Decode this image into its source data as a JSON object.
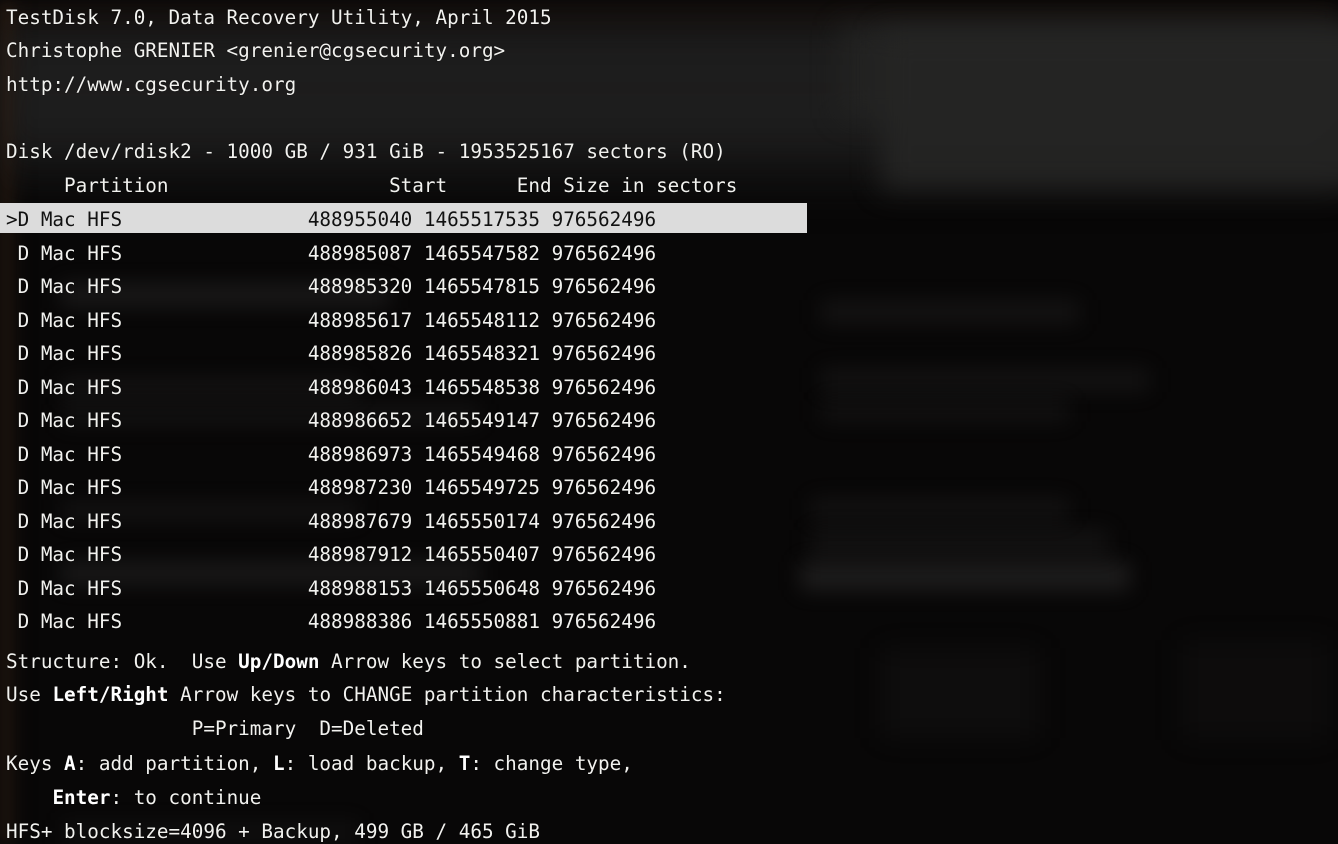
{
  "app": {
    "title_line": "TestDisk 7.0, Data Recovery Utility, April 2015",
    "author_line": "Christophe GRENIER <grenier@cgsecurity.org>",
    "website_line": "http://www.cgsecurity.org"
  },
  "disk": {
    "info_line": "Disk /dev/rdisk2 - 1000 GB / 931 GiB - 1953525167 sectors (RO)",
    "device": "/dev/rdisk2",
    "size_gb": "1000 GB",
    "size_gib": "931 GiB",
    "sectors": "1953525167",
    "mode": "RO"
  },
  "table": {
    "headers": {
      "partition": "Partition",
      "start": "Start",
      "end": "End",
      "size": "Size in sectors"
    },
    "selected_index": 0,
    "selection_marker": ">",
    "rows": [
      {
        "marker": ">",
        "flag": "D",
        "type": "Mac HFS",
        "start": "488955040",
        "end": "1465517535",
        "size": "976562496",
        "selected": true
      },
      {
        "marker": " ",
        "flag": "D",
        "type": "Mac HFS",
        "start": "488985087",
        "end": "1465547582",
        "size": "976562496",
        "selected": false
      },
      {
        "marker": " ",
        "flag": "D",
        "type": "Mac HFS",
        "start": "488985320",
        "end": "1465547815",
        "size": "976562496",
        "selected": false
      },
      {
        "marker": " ",
        "flag": "D",
        "type": "Mac HFS",
        "start": "488985617",
        "end": "1465548112",
        "size": "976562496",
        "selected": false
      },
      {
        "marker": " ",
        "flag": "D",
        "type": "Mac HFS",
        "start": "488985826",
        "end": "1465548321",
        "size": "976562496",
        "selected": false
      },
      {
        "marker": " ",
        "flag": "D",
        "type": "Mac HFS",
        "start": "488986043",
        "end": "1465548538",
        "size": "976562496",
        "selected": false
      },
      {
        "marker": " ",
        "flag": "D",
        "type": "Mac HFS",
        "start": "488986652",
        "end": "1465549147",
        "size": "976562496",
        "selected": false
      },
      {
        "marker": " ",
        "flag": "D",
        "type": "Mac HFS",
        "start": "488986973",
        "end": "1465549468",
        "size": "976562496",
        "selected": false
      },
      {
        "marker": " ",
        "flag": "D",
        "type": "Mac HFS",
        "start": "488987230",
        "end": "1465549725",
        "size": "976562496",
        "selected": false
      },
      {
        "marker": " ",
        "flag": "D",
        "type": "Mac HFS",
        "start": "488987679",
        "end": "1465550174",
        "size": "976562496",
        "selected": false
      },
      {
        "marker": " ",
        "flag": "D",
        "type": "Mac HFS",
        "start": "488987912",
        "end": "1465550407",
        "size": "976562496",
        "selected": false
      },
      {
        "marker": " ",
        "flag": "D",
        "type": "Mac HFS",
        "start": "488988153",
        "end": "1465550648",
        "size": "976562496",
        "selected": false
      },
      {
        "marker": " ",
        "flag": "D",
        "type": "Mac HFS",
        "start": "488988386",
        "end": "1465550881",
        "size": "976562496",
        "selected": false
      }
    ]
  },
  "status": {
    "structure_prefix": "Structure: Ok.  Use ",
    "structure_key": "Up/Down",
    "structure_suffix": " Arrow keys to select partition.",
    "change_prefix": "Use ",
    "change_key": "Left/Right",
    "change_suffix": " Arrow keys to CHANGE partition characteristics:",
    "legend_line": "                P=Primary  D=Deleted"
  },
  "keys": {
    "prefix": "Keys ",
    "add_key": "A",
    "add_text": ": add partition, ",
    "load_key": "L",
    "load_text": ": load backup, ",
    "type_key": "T",
    "type_text": ": change type,",
    "enter_indent": "    ",
    "enter_key": "Enter",
    "enter_text": ": to continue"
  },
  "footer": {
    "fs_line": "HFS+ blocksize=4096 + Backup, 499 GB / 465 GiB",
    "filesystem": "HFS+",
    "blocksize": "4096",
    "backup": "Backup",
    "size_gb": "499 GB",
    "size_gib": "465 GiB"
  },
  "colors": {
    "background": "#070605",
    "foreground": "#f2f2ef",
    "highlight_bg": "#dcdcdc",
    "highlight_fg": "#111111"
  }
}
